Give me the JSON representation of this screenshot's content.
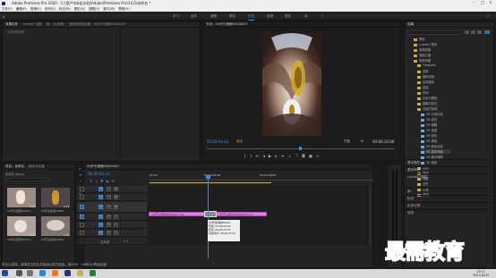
{
  "titlebar": {
    "title": "Adobe Premiere Pro 2020 - C:\\用户\\tdzq\\文档\\Adobe\\Premiere Pro\\14.0\\未命名 *"
  },
  "menu": [
    "文件(F)",
    "编辑(E)",
    "剪辑(C)",
    "序列(S)",
    "标记(M)",
    "图形(G)",
    "视图(V)",
    "窗口(W)",
    "帮助(H)"
  ],
  "workspaces": [
    "学习",
    "组件",
    "编辑",
    "颜色",
    "效果",
    "音频",
    "图形",
    "库"
  ],
  "workspaces_active": 4,
  "left_panel": {
    "tabs": [
      "效果控件",
      "Lumetri 范围",
      "源：(无剪辑)",
      "音频剪辑混合器：00开头视频00000007"
    ],
    "placeholder": "(未选择剪辑)"
  },
  "program": {
    "tab": "节目：00开头视频00000007",
    "timecode": "00;00;04;24",
    "fit": "适合",
    "full": "完整",
    "duration": "00;00;10;06"
  },
  "project": {
    "tabs": [
      "项目：未命名",
      "媒体浏览器"
    ],
    "name": "未命名.prproj",
    "items": [
      "00开头视频00000...",
      "00开头视频00000...",
      "00开头视频00000...",
      "00开头视频00000..."
    ],
    "item_durations": [
      "4:24",
      "5:24",
      "5:24",
      "5:24"
    ]
  },
  "timeline": {
    "tab": "00开头视频00000007",
    "timecode": "00;00;04;24",
    "ruler": [
      "00;00",
      "00;00;04;00",
      "00;00;08;00"
    ],
    "tracks": [
      "V3",
      "V2",
      "V1",
      "A1",
      "A2",
      "A3"
    ],
    "master": "主声道",
    "master_val": "0.0",
    "clip1": "00开头视频00000007.mp",
    "clip2": "00开头视频00000008.mp",
    "tooltip": [
      "00开头视频00000...",
      "开始: 00;00;04;24",
      "结束: 00;00;10;05",
      "持续时间: 00;00;05;12"
    ]
  },
  "effects": {
    "title": "效果",
    "tree": [
      "预设",
      "Lumetri 预设",
      "音频效果",
      "音频过渡",
      "视频效果",
      "Obsolete",
      "变换",
      "图像控制",
      "实用程序",
      "扭曲",
      "时间",
      "杂色与颗粒",
      "模糊与锐化",
      "沉浸式视频",
      "VR 分形杂色",
      "VR 发光",
      "VR 模糊",
      "VR 色差",
      "VR 锐化",
      "VR 降噪",
      "VR 颜色渐变",
      "VR 旋转球面",
      "VR 数字故障",
      "VR 投影",
      "生成",
      "视频",
      "调整",
      "过时",
      "过渡",
      "透视"
    ],
    "sections": [
      "基本图形",
      "基本声音",
      "Lumetri 颜色",
      "库",
      "标记",
      "历史记录",
      "信息"
    ]
  },
  "status": "单击以选择，或单击空白处并拖动以进行选择，用Shift、Alt和Ctrl等组合键",
  "taskbar": {
    "time": "19:12",
    "date": "2021/10/22"
  },
  "watermark": "最需教育",
  "colors": {
    "accent": "#3b8bd6",
    "clip": "#e67ee8"
  }
}
